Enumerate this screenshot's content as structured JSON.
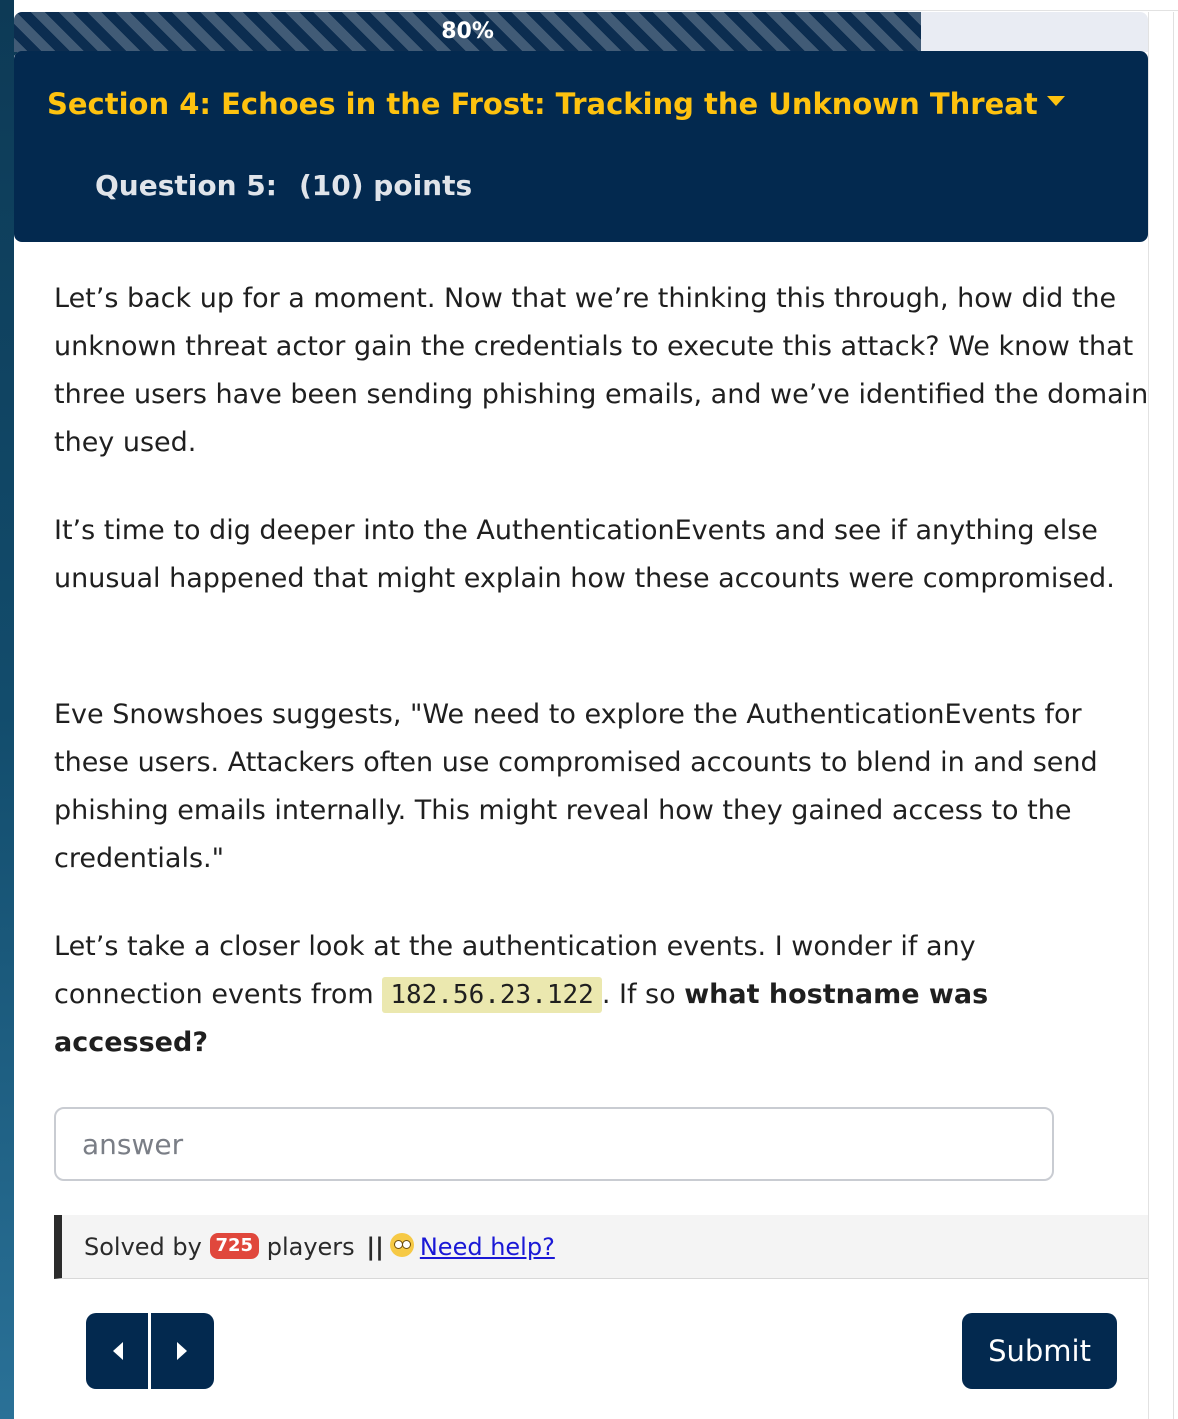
{
  "progress": {
    "label": "80%",
    "value": 0.8
  },
  "header": {
    "section_title": "Section 4: Echoes in the Frost: Tracking the Unknown Threat",
    "question_label": "Question 5:",
    "points": "(10) points"
  },
  "content": {
    "p1": "Let’s back up for a moment. Now that we’re thinking this through, how did the unknown threat actor gain the credentials to execute this attack? We know that three users have been sending phishing emails, and we’ve identified the domain they used.",
    "p2": "It’s time to dig deeper into the AuthenticationEvents and see if anything else unusual happened that might explain how these accounts were compromised.",
    "p3": "Eve Snowshoes suggests, \"We need to explore the AuthenticationEvents for these users. Attackers often use compromised accounts to blend in and send phishing emails internally. This might reveal how they gained access to the credentials.\"",
    "p4_before": "Let’s take a closer look at the authentication events. I wonder if any connection events from ",
    "p4_code": "182.56.23.122",
    "p4_mid": ". If so ",
    "p4_bold": "what hostname was accessed?"
  },
  "answer": {
    "placeholder": "answer",
    "value": ""
  },
  "solved": {
    "prefix": "Solved by",
    "count": "725",
    "suffix": "players",
    "separator": "||",
    "help_icon": "confused-face-icon",
    "help_text": "Need help?"
  },
  "nav": {
    "prev_icon": "caret-left-icon",
    "next_icon": "caret-right-icon"
  },
  "submit_label": "Submit",
  "colors": {
    "header_bg": "#03294f",
    "section_title": "#fec20f",
    "badge": "#e0473c",
    "code_bg": "#ebe8af",
    "link": "#1a18d6"
  }
}
